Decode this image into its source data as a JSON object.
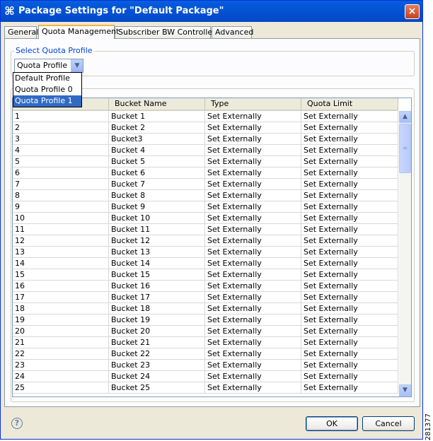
{
  "window": {
    "title": "Package Settings for \"Default Package\"",
    "close_label": "×",
    "accent_color": "#0458d8"
  },
  "tabs": [
    {
      "label": "General",
      "active": false
    },
    {
      "label": "Quota Management",
      "active": true
    },
    {
      "label": "Subscriber BW Controllers",
      "active": false
    },
    {
      "label": "Advanced",
      "active": false
    }
  ],
  "quota_profile": {
    "group_label": "Select Quota Profile",
    "selected": "Quota Profile 1",
    "options": [
      "Default Profile",
      "Quota Profile 0",
      "Quota Profile 1"
    ],
    "dropdown_open": true
  },
  "bucket_table": {
    "columns": [
      "",
      "Bucket Name",
      "Type",
      "Quota Limit"
    ],
    "rows": [
      [
        "1",
        "Bucket 1",
        "Set Externally",
        "Set Externally"
      ],
      [
        "2",
        "Bucket 2",
        "Set Externally",
        "Set Externally"
      ],
      [
        "3",
        "Bucket3",
        "Set Externally",
        "Set Externally"
      ],
      [
        "4",
        "Bucket 4",
        "Set Externally",
        "Set Externally"
      ],
      [
        "5",
        "Bucket 5",
        "Set Externally",
        "Set Externally"
      ],
      [
        "6",
        "Bucket 6",
        "Set Externally",
        "Set Externally"
      ],
      [
        "7",
        "Bucket 7",
        "Set Externally",
        "Set Externally"
      ],
      [
        "8",
        "Bucket 8",
        "Set Externally",
        "Set Externally"
      ],
      [
        "9",
        "Bucket 9",
        "Set Externally",
        "Set Externally"
      ],
      [
        "10",
        "Bucket 10",
        "Set Externally",
        "Set Externally"
      ],
      [
        "11",
        "Bucket 11",
        "Set Externally",
        "Set Externally"
      ],
      [
        "12",
        "Bucket 12",
        "Set Externally",
        "Set Externally"
      ],
      [
        "13",
        "Bucket 13",
        "Set Externally",
        "Set Externally"
      ],
      [
        "14",
        "Bucket 14",
        "Set Externally",
        "Set Externally"
      ],
      [
        "15",
        "Bucket 15",
        "Set Externally",
        "Set Externally"
      ],
      [
        "16",
        "Bucket 16",
        "Set Externally",
        "Set Externally"
      ],
      [
        "17",
        "Bucket 17",
        "Set Externally",
        "Set Externally"
      ],
      [
        "18",
        "Bucket 18",
        "Set Externally",
        "Set Externally"
      ],
      [
        "19",
        "Bucket 19",
        "Set Externally",
        "Set Externally"
      ],
      [
        "20",
        "Bucket 20",
        "Set Externally",
        "Set Externally"
      ],
      [
        "21",
        "Bucket 21",
        "Set Externally",
        "Set Externally"
      ],
      [
        "22",
        "Bucket 22",
        "Set Externally",
        "Set Externally"
      ],
      [
        "23",
        "Bucket 23",
        "Set Externally",
        "Set Externally"
      ],
      [
        "24",
        "Bucket 24",
        "Set Externally",
        "Set Externally"
      ],
      [
        "25",
        "Bucket 25",
        "Set Externally",
        "Set Externally"
      ]
    ]
  },
  "footer": {
    "help_icon": "question-circle-icon",
    "ok_label": "OK",
    "cancel_label": "Cancel"
  },
  "figure_id": "281377"
}
